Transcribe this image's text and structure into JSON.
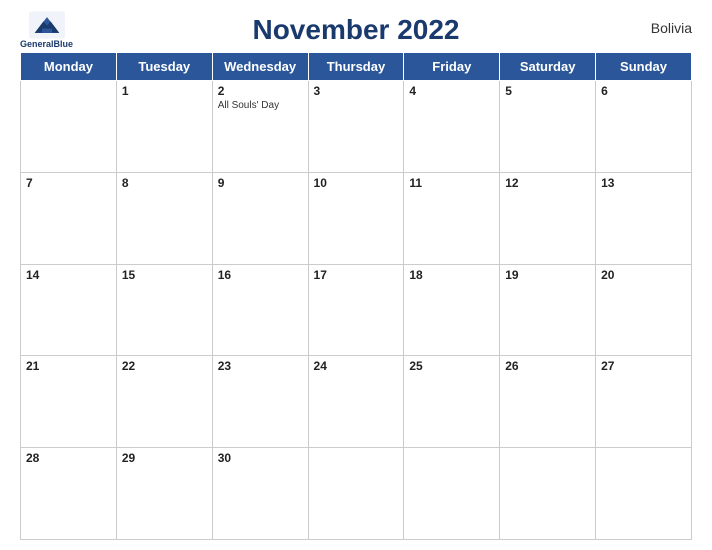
{
  "header": {
    "title": "November 2022",
    "country": "Bolivia",
    "logo_name": "GeneralBlue",
    "logo_line1": "General",
    "logo_line2": "Blue"
  },
  "weekdays": [
    "Monday",
    "Tuesday",
    "Wednesday",
    "Thursday",
    "Friday",
    "Saturday",
    "Sunday"
  ],
  "weeks": [
    [
      {
        "day": "",
        "event": ""
      },
      {
        "day": "1",
        "event": ""
      },
      {
        "day": "2",
        "event": "All Souls' Day"
      },
      {
        "day": "3",
        "event": ""
      },
      {
        "day": "4",
        "event": ""
      },
      {
        "day": "5",
        "event": ""
      },
      {
        "day": "6",
        "event": ""
      }
    ],
    [
      {
        "day": "7",
        "event": ""
      },
      {
        "day": "8",
        "event": ""
      },
      {
        "day": "9",
        "event": ""
      },
      {
        "day": "10",
        "event": ""
      },
      {
        "day": "11",
        "event": ""
      },
      {
        "day": "12",
        "event": ""
      },
      {
        "day": "13",
        "event": ""
      }
    ],
    [
      {
        "day": "14",
        "event": ""
      },
      {
        "day": "15",
        "event": ""
      },
      {
        "day": "16",
        "event": ""
      },
      {
        "day": "17",
        "event": ""
      },
      {
        "day": "18",
        "event": ""
      },
      {
        "day": "19",
        "event": ""
      },
      {
        "day": "20",
        "event": ""
      }
    ],
    [
      {
        "day": "21",
        "event": ""
      },
      {
        "day": "22",
        "event": ""
      },
      {
        "day": "23",
        "event": ""
      },
      {
        "day": "24",
        "event": ""
      },
      {
        "day": "25",
        "event": ""
      },
      {
        "day": "26",
        "event": ""
      },
      {
        "day": "27",
        "event": ""
      }
    ],
    [
      {
        "day": "28",
        "event": ""
      },
      {
        "day": "29",
        "event": ""
      },
      {
        "day": "30",
        "event": ""
      },
      {
        "day": "",
        "event": ""
      },
      {
        "day": "",
        "event": ""
      },
      {
        "day": "",
        "event": ""
      },
      {
        "day": "",
        "event": ""
      }
    ]
  ]
}
